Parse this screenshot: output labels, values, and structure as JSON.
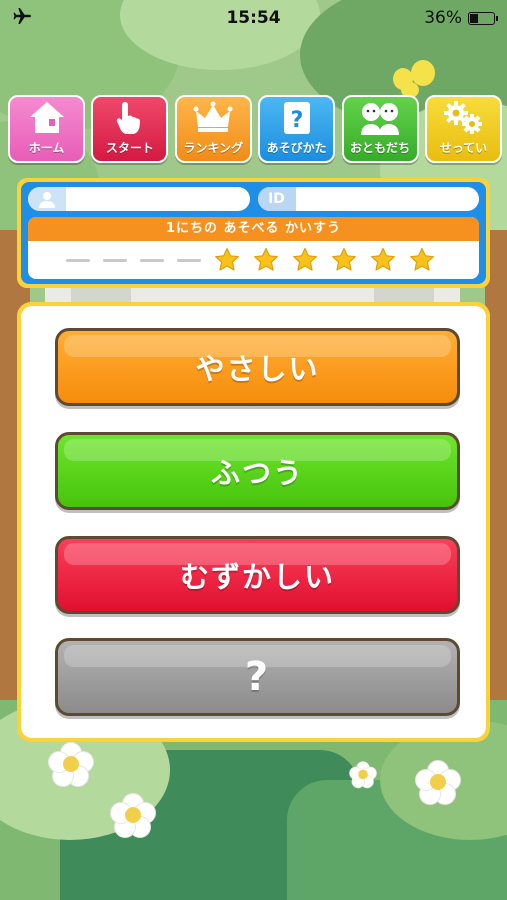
{
  "status_bar": {
    "time": "15:54",
    "battery_percent": "36%",
    "battery_level": 0.36
  },
  "nav": {
    "items": [
      {
        "label": "ホーム",
        "icon": "house-icon",
        "color": "#e75db8"
      },
      {
        "label": "スタート",
        "icon": "pointing-hand-icon",
        "color": "#d31a43"
      },
      {
        "label": "ランキング",
        "icon": "crown-icon",
        "color": "#f08c17"
      },
      {
        "label": "あそびかた",
        "icon": "question-icon",
        "color": "#1c8ee0"
      },
      {
        "label": "おともだち",
        "icon": "friends-icon",
        "color": "#36ac2a"
      },
      {
        "label": "せってい",
        "icon": "gears-icon",
        "color": "#e9bd10"
      }
    ]
  },
  "profile": {
    "user_icon": "user-icon",
    "name_value": "",
    "id_label": "ID",
    "id_value": ""
  },
  "plays": {
    "title": "1にちの あそべる かいすう",
    "used": 4,
    "remaining": 6
  },
  "difficulty": {
    "easy": "やさしい",
    "normal": "ふつう",
    "hard": "むずかしい",
    "secret": "?"
  }
}
